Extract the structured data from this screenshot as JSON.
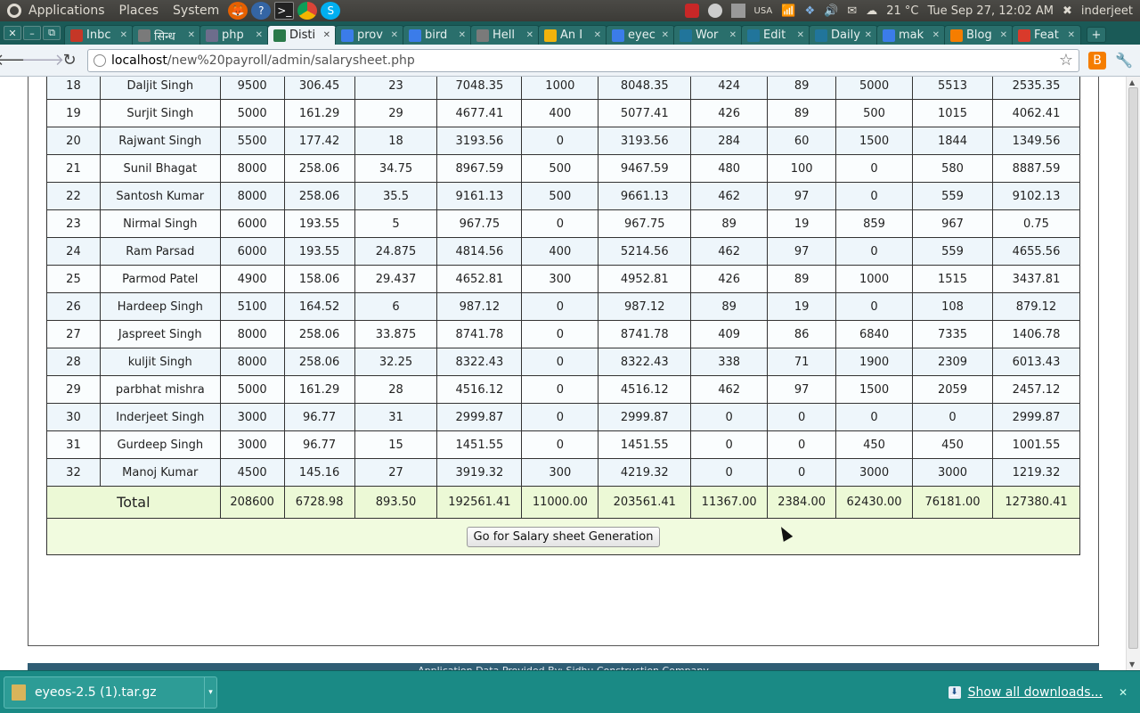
{
  "panel": {
    "menus": [
      "Applications",
      "Places",
      "System"
    ],
    "keyboard_layout": "USA",
    "weather": "21 °C",
    "datetime": "Tue Sep 27, 12:02 AM",
    "user": "inderjeet"
  },
  "tabs": [
    {
      "title": "Inbc",
      "icon": "gmail-icon",
      "color": "#c53727",
      "active": false
    },
    {
      "title": "सिन्ध",
      "icon": "globe-icon",
      "color": "#7a7a7a",
      "active": false
    },
    {
      "title": "php",
      "icon": "php-icon",
      "color": "#6d6d8c",
      "active": false
    },
    {
      "title": "Disti",
      "icon": "globe-icon",
      "color": "#2a7a4a",
      "active": true
    },
    {
      "title": "prov",
      "icon": "google-icon",
      "color": "#3b7ce9",
      "active": false
    },
    {
      "title": "bird",
      "icon": "google-icon",
      "color": "#3b7ce9",
      "active": false
    },
    {
      "title": "Hell",
      "icon": "globe-icon",
      "color": "#7a7a7a",
      "active": false
    },
    {
      "title": "An I",
      "icon": "lp-icon",
      "color": "#f2b30c",
      "active": false
    },
    {
      "title": "eyec",
      "icon": "google-icon",
      "color": "#3b7ce9",
      "active": false
    },
    {
      "title": "Wor",
      "icon": "wordpress-icon",
      "color": "#21759b",
      "active": false
    },
    {
      "title": "Edit",
      "icon": "wordpress-icon",
      "color": "#21759b",
      "active": false
    },
    {
      "title": "Daily",
      "icon": "wordpress-icon",
      "color": "#21759b",
      "active": false
    },
    {
      "title": "mak",
      "icon": "google-icon",
      "color": "#3b7ce9",
      "active": false
    },
    {
      "title": "Blog",
      "icon": "blogger-icon",
      "color": "#f57d00",
      "active": false
    },
    {
      "title": "Feat",
      "icon": "feature-icon",
      "color": "#d93a2b",
      "active": false
    }
  ],
  "toolbar": {
    "url_host": "localhost",
    "url_path": "/new%20payroll/admin/salarysheet.php"
  },
  "sheet": {
    "rows": [
      [
        "18",
        "Daljit Singh",
        "9500",
        "306.45",
        "23",
        "7048.35",
        "1000",
        "8048.35",
        "424",
        "89",
        "5000",
        "5513",
        "2535.35"
      ],
      [
        "19",
        "Surjit Singh",
        "5000",
        "161.29",
        "29",
        "4677.41",
        "400",
        "5077.41",
        "426",
        "89",
        "500",
        "1015",
        "4062.41"
      ],
      [
        "20",
        "Rajwant Singh",
        "5500",
        "177.42",
        "18",
        "3193.56",
        "0",
        "3193.56",
        "284",
        "60",
        "1500",
        "1844",
        "1349.56"
      ],
      [
        "21",
        "Sunil Bhagat",
        "8000",
        "258.06",
        "34.75",
        "8967.59",
        "500",
        "9467.59",
        "480",
        "100",
        "0",
        "580",
        "8887.59"
      ],
      [
        "22",
        "Santosh Kumar",
        "8000",
        "258.06",
        "35.5",
        "9161.13",
        "500",
        "9661.13",
        "462",
        "97",
        "0",
        "559",
        "9102.13"
      ],
      [
        "23",
        "Nirmal Singh",
        "6000",
        "193.55",
        "5",
        "967.75",
        "0",
        "967.75",
        "89",
        "19",
        "859",
        "967",
        "0.75"
      ],
      [
        "24",
        "Ram Parsad",
        "6000",
        "193.55",
        "24.875",
        "4814.56",
        "400",
        "5214.56",
        "462",
        "97",
        "0",
        "559",
        "4655.56"
      ],
      [
        "25",
        "Parmod Patel",
        "4900",
        "158.06",
        "29.437",
        "4652.81",
        "300",
        "4952.81",
        "426",
        "89",
        "1000",
        "1515",
        "3437.81"
      ],
      [
        "26",
        "Hardeep Singh",
        "5100",
        "164.52",
        "6",
        "987.12",
        "0",
        "987.12",
        "89",
        "19",
        "0",
        "108",
        "879.12"
      ],
      [
        "27",
        "Jaspreet Singh",
        "8000",
        "258.06",
        "33.875",
        "8741.78",
        "0",
        "8741.78",
        "409",
        "86",
        "6840",
        "7335",
        "1406.78"
      ],
      [
        "28",
        "kuljit Singh",
        "8000",
        "258.06",
        "32.25",
        "8322.43",
        "0",
        "8322.43",
        "338",
        "71",
        "1900",
        "2309",
        "6013.43"
      ],
      [
        "29",
        "parbhat mishra",
        "5000",
        "161.29",
        "28",
        "4516.12",
        "0",
        "4516.12",
        "462",
        "97",
        "1500",
        "2059",
        "2457.12"
      ],
      [
        "30",
        "Inderjeet Singh",
        "3000",
        "96.77",
        "31",
        "2999.87",
        "0",
        "2999.87",
        "0",
        "0",
        "0",
        "0",
        "2999.87"
      ],
      [
        "31",
        "Gurdeep Singh",
        "3000",
        "96.77",
        "15",
        "1451.55",
        "0",
        "1451.55",
        "0",
        "0",
        "450",
        "450",
        "1001.55"
      ],
      [
        "32",
        "Manoj Kumar",
        "4500",
        "145.16",
        "27",
        "3919.32",
        "300",
        "4219.32",
        "0",
        "0",
        "3000",
        "3000",
        "1219.32"
      ]
    ],
    "total_label": "Total",
    "totals": [
      "208600",
      "6728.98",
      "893.50",
      "192561.41",
      "11000.00",
      "203561.41",
      "11367.00",
      "2384.00",
      "62430.00",
      "76181.00",
      "127380.41"
    ],
    "generate_button": "Go for Salary sheet Generation"
  },
  "footer_text": "Application Data Provided By: Sidhu Construction Company",
  "downloads": {
    "file": "eyeos-2.5 (1).tar.gz",
    "show_all": "Show all downloads..."
  }
}
